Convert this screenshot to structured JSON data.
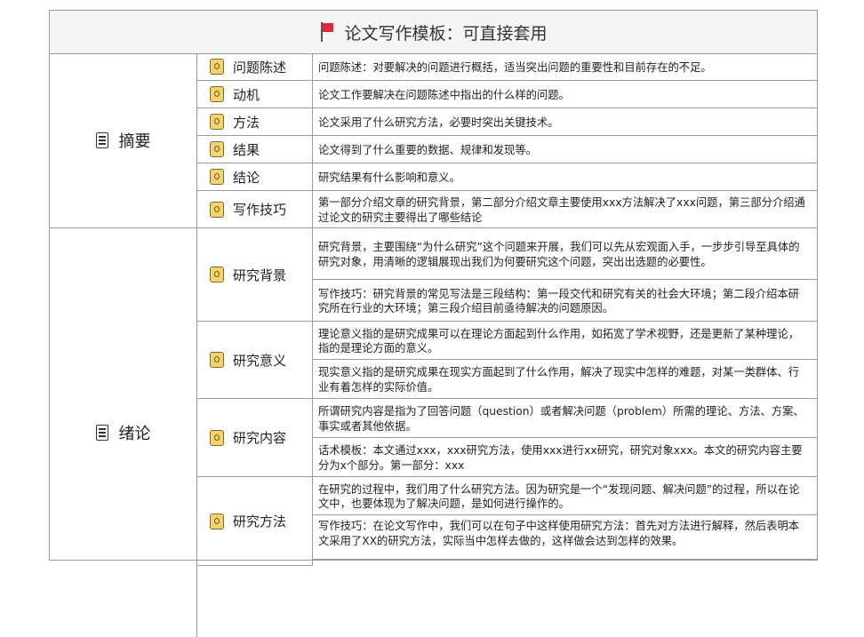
{
  "title": "论文写作模板：可直接套用",
  "sections": {
    "abstract": {
      "label": "摘要",
      "rows": [
        {
          "label": "问题陈述",
          "text": "问题陈述：对要解决的问题进行概括，适当突出问题的重要性和目前存在的不足。"
        },
        {
          "label": "动机",
          "text": "论文工作要解决在问题陈述中指出的什么样的问题。"
        },
        {
          "label": "方法",
          "text": "论文采用了什么研究方法，必要时突出关键技术。"
        },
        {
          "label": "结果",
          "text": "论文得到了什么重要的数据、规律和发现等。"
        },
        {
          "label": "结论",
          "text": "研究结果有什么影响和意义。"
        },
        {
          "label": "写作技巧",
          "text": "第一部分介绍文章的研究背景，第二部分介绍文章主要使用xxx方法解决了xxx问题，第三部分介绍通过论文的研究主要得出了哪些结论"
        }
      ]
    },
    "intro": {
      "label": "绪论",
      "rows": [
        {
          "label": "研究背景",
          "texts": [
            "研究背景，主要围绕“为什么研究”这个问题来开展，我们可以先从宏观面入手，一步步引导至具体的研究对象，用清晰的逻辑展现出我们为何要研究这个问题，突出出选题的必要性。",
            "写作技巧：研究背景的常见写法是三段结构：第一段交代和研究有关的社会大环境；第二段介绍本研究所在行业的大环境；第三段介绍目前亟待解决的问题原因。"
          ]
        },
        {
          "label": "研究意义",
          "texts": [
            "理论意义指的是研究成果可以在理论方面起到什么作用，如拓宽了学术视野，还是更新了某种理论，指的是理论方面的意义。",
            "现实意义指的是研究成果在现实方面起到了什么作用，解决了现实中怎样的难题，对某一类群体、行业有着怎样的实际价值。"
          ]
        },
        {
          "label": "研究内容",
          "texts": [
            "所谓研究内容是指为了回答问题（question）或者解决问题（problem）所需的理论、方法、方案、事实或者其他依据。",
            "话术模板：本文通过xxx，xxx研究方法，使用xxx进行xx研究，研究对象xxx。本文的研究内容主要分为x个部分。第一部分：xxx"
          ]
        },
        {
          "label": "研究方法",
          "texts": [
            "在研究的过程中，我们用了什么研究方法。因为研究是一个“发现问题、解决问题”的过程，所以在论文中，也要体现为了解决问题，是如何进行操作的。",
            "写作技巧：在论文写作中，我们可以在句子中这样使用研究方法：首先对方法进行解释，然后表明本文采用了XX的研究方法，实际当中怎样去做的，这样做会达到怎样的效果。"
          ]
        }
      ]
    }
  }
}
